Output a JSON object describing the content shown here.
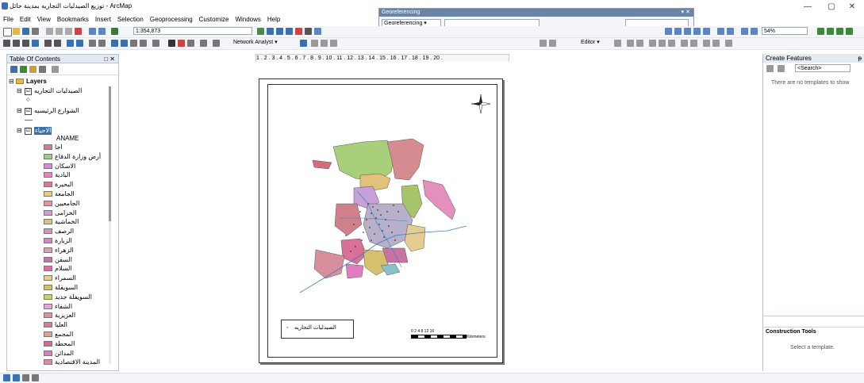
{
  "window": {
    "title": "توزيع الصيدليات التجاريه بمدينة حائل - ArcMap",
    "minimize": "—",
    "maximize": "▢",
    "close": "✕"
  },
  "menu": [
    "File",
    "Edit",
    "View",
    "Bookmarks",
    "Insert",
    "Selection",
    "Geoprocessing",
    "Customize",
    "Windows",
    "Help"
  ],
  "toolbar": {
    "scale": "1:354,873",
    "zoom": "54%",
    "network_analyst": "Network Analyst ▾",
    "editor": "Editor ▾"
  },
  "georeferencing": {
    "title": "Georeferencing",
    "close": "▾ ✕",
    "combo_label": "Georeferencing ▾"
  },
  "toc": {
    "title": "Table Of Contents",
    "close": "□ ✕",
    "root": "Layers",
    "layers": [
      {
        "name": "الصيدليات التجاريه",
        "checked": "☑"
      },
      {
        "name": "الشوارع الرئيسيه",
        "checked": "☑"
      },
      {
        "name": "الاحياء",
        "checked": "☑",
        "field": "ANAME"
      }
    ],
    "symbol_point": "◇",
    "classes": [
      {
        "name": "اجا",
        "color": "#c9808f"
      },
      {
        "name": "أرض وزارة الدفاع",
        "color": "#9ed07a"
      },
      {
        "name": "الاسكان",
        "color": "#d58bd6"
      },
      {
        "name": "البادية",
        "color": "#e585bd"
      },
      {
        "name": "البحيرة",
        "color": "#d87aa0"
      },
      {
        "name": "الجامعة",
        "color": "#ddd08a"
      },
      {
        "name": "الجامعيين",
        "color": "#e890a8"
      },
      {
        "name": "الخزامى",
        "color": "#c6a0d6"
      },
      {
        "name": "الخماشية",
        "color": "#e3c17a"
      },
      {
        "name": "الرصف",
        "color": "#d792c8"
      },
      {
        "name": "الزبارة",
        "color": "#d784d1"
      },
      {
        "name": "الزهراء",
        "color": "#e19fb3"
      },
      {
        "name": "السفن",
        "color": "#c774a4"
      },
      {
        "name": "السلام",
        "color": "#dc6f98"
      },
      {
        "name": "السمراء",
        "color": "#e4ce8f"
      },
      {
        "name": "السويفلة",
        "color": "#d6c06e"
      },
      {
        "name": "السويفلة جديد",
        "color": "#c8d070"
      },
      {
        "name": "الشفاء",
        "color": "#e0a4dc"
      },
      {
        "name": "العزيزية",
        "color": "#e38fa2"
      },
      {
        "name": "العليا",
        "color": "#d0808a"
      },
      {
        "name": "المجمع",
        "color": "#e2a090"
      },
      {
        "name": "المحطة",
        "color": "#d26c90"
      },
      {
        "name": "المدائن",
        "color": "#e07cc0"
      },
      {
        "name": "المدينة الاقتصادية",
        "color": "#d88f9c"
      }
    ]
  },
  "ruler": "1 . 2 . 3 . 4 . 5 . 6 . 7 . 8 . 9 . 10 . 11 . 12 . 13 . 14 . 15 . 16 . 17 . 18 . 19 . 20 .",
  "layout": {
    "legend_label": "الصيدليات التجاريه",
    "legend_symbol": "◦",
    "scale_numbers": "0  2  4     8      12     16",
    "scale_unit": "Kilometers",
    "north": "N"
  },
  "right_panel": {
    "title": "Create Features",
    "pin": "ᵽ",
    "search_placeholder": "<Search>",
    "empty_msg": "There are no templates to show",
    "construction_title": "Construction Tools",
    "construction_msg": "Select a template."
  },
  "colors": {
    "toolbar_bg": "#f3f5f8",
    "panel_header": "#e4eaf2",
    "accent": "#3a6fb0"
  }
}
